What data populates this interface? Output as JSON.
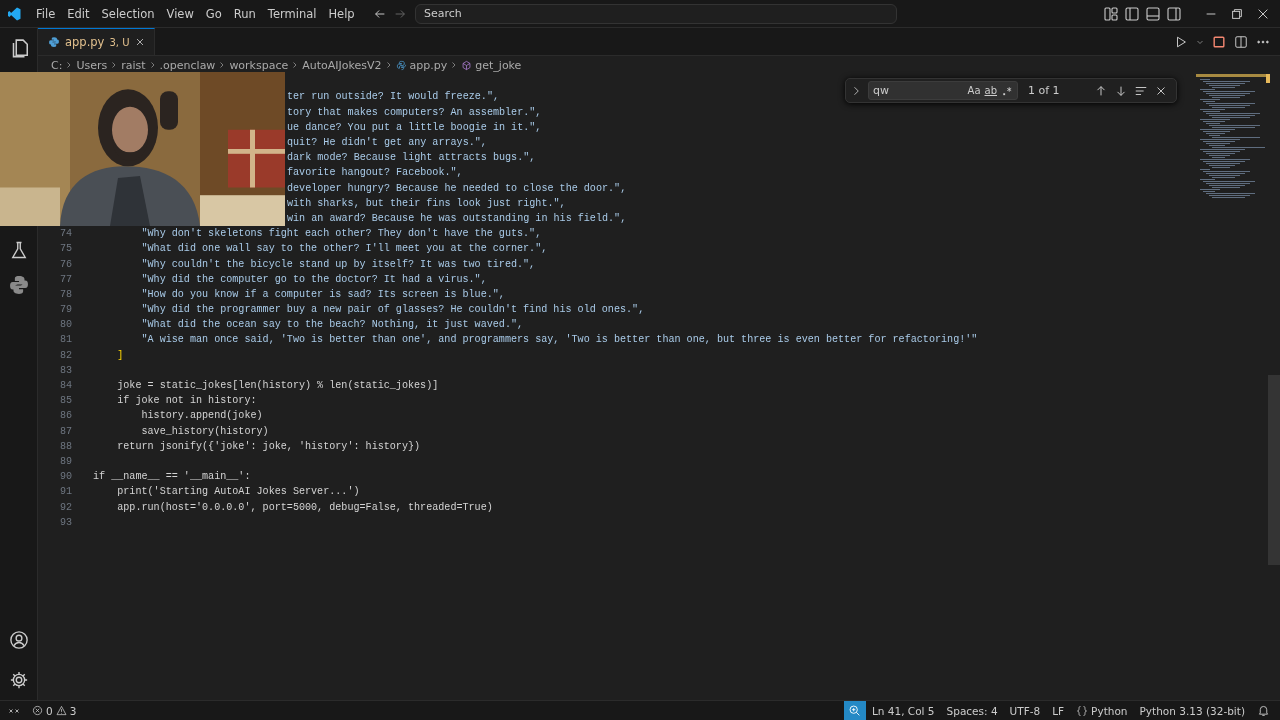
{
  "menu": [
    "File",
    "Edit",
    "Selection",
    "View",
    "Go",
    "Run",
    "Terminal",
    "Help"
  ],
  "search": {
    "placeholder": "Search"
  },
  "tabs": [
    {
      "label": "app.py",
      "badge": "3, U",
      "selected": true
    }
  ],
  "breadcrumbs": [
    {
      "label": "C:",
      "kind": "folder"
    },
    {
      "label": "Users",
      "kind": "folder"
    },
    {
      "label": "raist",
      "kind": "folder"
    },
    {
      "label": ".openclaw",
      "kind": "folder"
    },
    {
      "label": "workspace",
      "kind": "folder"
    },
    {
      "label": "AutoAIJokesV2",
      "kind": "folder"
    },
    {
      "label": "app.py",
      "kind": "file"
    },
    {
      "label": "get_joke",
      "kind": "symbol"
    }
  ],
  "find": {
    "value": "qw",
    "match_case": "Aa",
    "whole_word": "ab",
    "result": "1 of 1"
  },
  "lines": [
    {
      "kind": "covered",
      "text": "ter run outside? It would freeze.\","
    },
    {
      "kind": "covered",
      "text": "tory that makes computers? An assembler.\","
    },
    {
      "kind": "covered",
      "text": "ue dance? You put a little boogie in it.\","
    },
    {
      "kind": "covered",
      "text": "quit? He didn't get any arrays.\","
    },
    {
      "kind": "covered",
      "text": "dark mode? Because light attracts bugs.\","
    },
    {
      "kind": "covered",
      "text": "favorite hangout? Facebook.\","
    },
    {
      "kind": "covered",
      "text": "developer hungry? Because he needed to close the door.\","
    },
    {
      "kind": "covered",
      "text": "with sharks, but their fins look just right.\","
    },
    {
      "kind": "covered",
      "text": "win an award? Because he was outstanding in his field.\","
    },
    {
      "kind": "string",
      "number": "74",
      "text": "        \"Why don't skeletons fight each other? They don't have the guts.\","
    },
    {
      "kind": "string",
      "number": "75",
      "text": "        \"What did one wall say to the other? I'll meet you at the corner.\","
    },
    {
      "kind": "string",
      "number": "76",
      "text": "        \"Why couldn't the bicycle stand up by itself? It was two tired.\","
    },
    {
      "kind": "string",
      "number": "77",
      "text": "        \"Why did the computer go to the doctor? It had a virus.\","
    },
    {
      "kind": "string",
      "number": "78",
      "text": "        \"How do you know if a computer is sad? Its screen is blue.\","
    },
    {
      "kind": "string",
      "number": "79",
      "text": "        \"Why did the programmer buy a new pair of glasses? He couldn't find his old ones.\","
    },
    {
      "kind": "string",
      "number": "80",
      "text": "        \"What did the ocean say to the beach? Nothing, it just waved.\","
    },
    {
      "kind": "string",
      "number": "81",
      "text": "        \"A wise man once said, 'Two is better than one', and programmers say, 'Two is better than one, but three is even better for refactoring!'\""
    },
    {
      "kind": "bracket",
      "number": "82",
      "text": "    ]"
    },
    {
      "kind": "code",
      "number": "83"
    },
    {
      "kind": "code",
      "number": "84",
      "text": "    joke = static_jokes[len(history) % len(static_jokes)]"
    },
    {
      "kind": "code",
      "number": "85",
      "text": "    if joke not in history:"
    },
    {
      "kind": "code",
      "number": "86",
      "text": "        history.append(joke)"
    },
    {
      "kind": "code",
      "number": "87",
      "text": "        save_history(history)"
    },
    {
      "kind": "code",
      "number": "88",
      "text": "    return jsonify({'joke': joke, 'history': history})"
    },
    {
      "kind": "code",
      "number": "89"
    },
    {
      "kind": "code",
      "number": "90",
      "text": "if __name__ == '__main__':"
    },
    {
      "kind": "code",
      "number": "91",
      "text": "    print('Starting AutoAI Jokes Server...')"
    },
    {
      "kind": "code",
      "number": "92",
      "text": "    app.run(host='0.0.0.0', port=5000, debug=False, threaded=True)"
    },
    {
      "kind": "code",
      "number": "93"
    }
  ],
  "status": {
    "errors": "0",
    "warnings": "3",
    "items": [
      "Ln 41, Col 5",
      "Spaces: 4",
      "UTF-8",
      "LF"
    ],
    "language": "Python",
    "interpreter": "Python 3.13 (32-bit)"
  }
}
